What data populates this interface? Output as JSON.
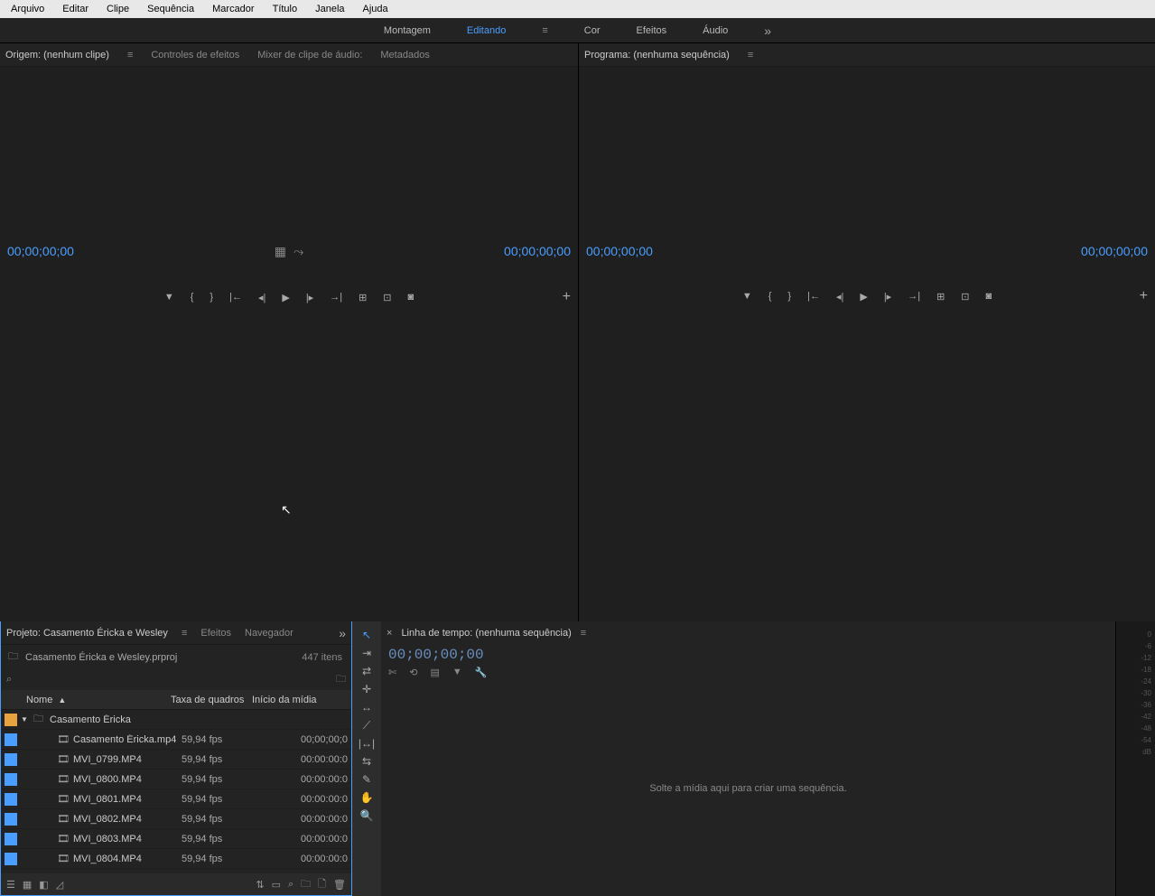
{
  "menubar": [
    "Arquivo",
    "Editar",
    "Clipe",
    "Sequência",
    "Marcador",
    "Título",
    "Janela",
    "Ajuda"
  ],
  "workspaces": {
    "items": [
      "Montagem",
      "Editando",
      "Cor",
      "Efeitos",
      "Áudio"
    ],
    "active": 1
  },
  "source_panel": {
    "tabs": [
      "Origem: (nenhum clipe)",
      "Controles de efeitos",
      "Mixer de clipe de áudio:",
      "Metadados"
    ],
    "active": 0,
    "tc_left": "00;00;00;00",
    "tc_right": "00;00;00;00"
  },
  "program_panel": {
    "title": "Programa: (nenhuma sequência)",
    "tc_left": "00;00;00;00",
    "tc_right": "00;00;00;00"
  },
  "project_panel": {
    "tabs": [
      "Projeto: Casamento Éricka e Wesley",
      "Efeitos",
      "Navegador"
    ],
    "filename": "Casamento Éricka e Wesley.prproj",
    "item_count": "447 itens",
    "columns": {
      "name": "Nome",
      "fps": "Taxa de quadros",
      "start": "Início da mídia"
    },
    "bin": {
      "name": "Casamento Éricka"
    },
    "rows": [
      {
        "name": "Casamento Éricka.mp4",
        "fps": "59,94 fps",
        "start": "00;00;00;0"
      },
      {
        "name": "MVI_0799.MP4",
        "fps": "59,94 fps",
        "start": "00:00:00:0"
      },
      {
        "name": "MVI_0800.MP4",
        "fps": "59,94 fps",
        "start": "00:00:00:0"
      },
      {
        "name": "MVI_0801.MP4",
        "fps": "59,94 fps",
        "start": "00:00:00:0"
      },
      {
        "name": "MVI_0802.MP4",
        "fps": "59,94 fps",
        "start": "00:00:00:0"
      },
      {
        "name": "MVI_0803.MP4",
        "fps": "59,94 fps",
        "start": "00:00:00:0"
      },
      {
        "name": "MVI_0804.MP4",
        "fps": "59,94 fps",
        "start": "00:00:00:0"
      }
    ]
  },
  "timeline_panel": {
    "title": "Linha de tempo: (nenhuma sequência)",
    "timecode": "00;00;00;00",
    "placeholder": "Solte a mídia aqui para criar uma sequência."
  },
  "audio_meters": [
    "0",
    "-6",
    "-12",
    "-18",
    "-24",
    "-30",
    "-36",
    "-42",
    "-48",
    "-54",
    "dB"
  ]
}
